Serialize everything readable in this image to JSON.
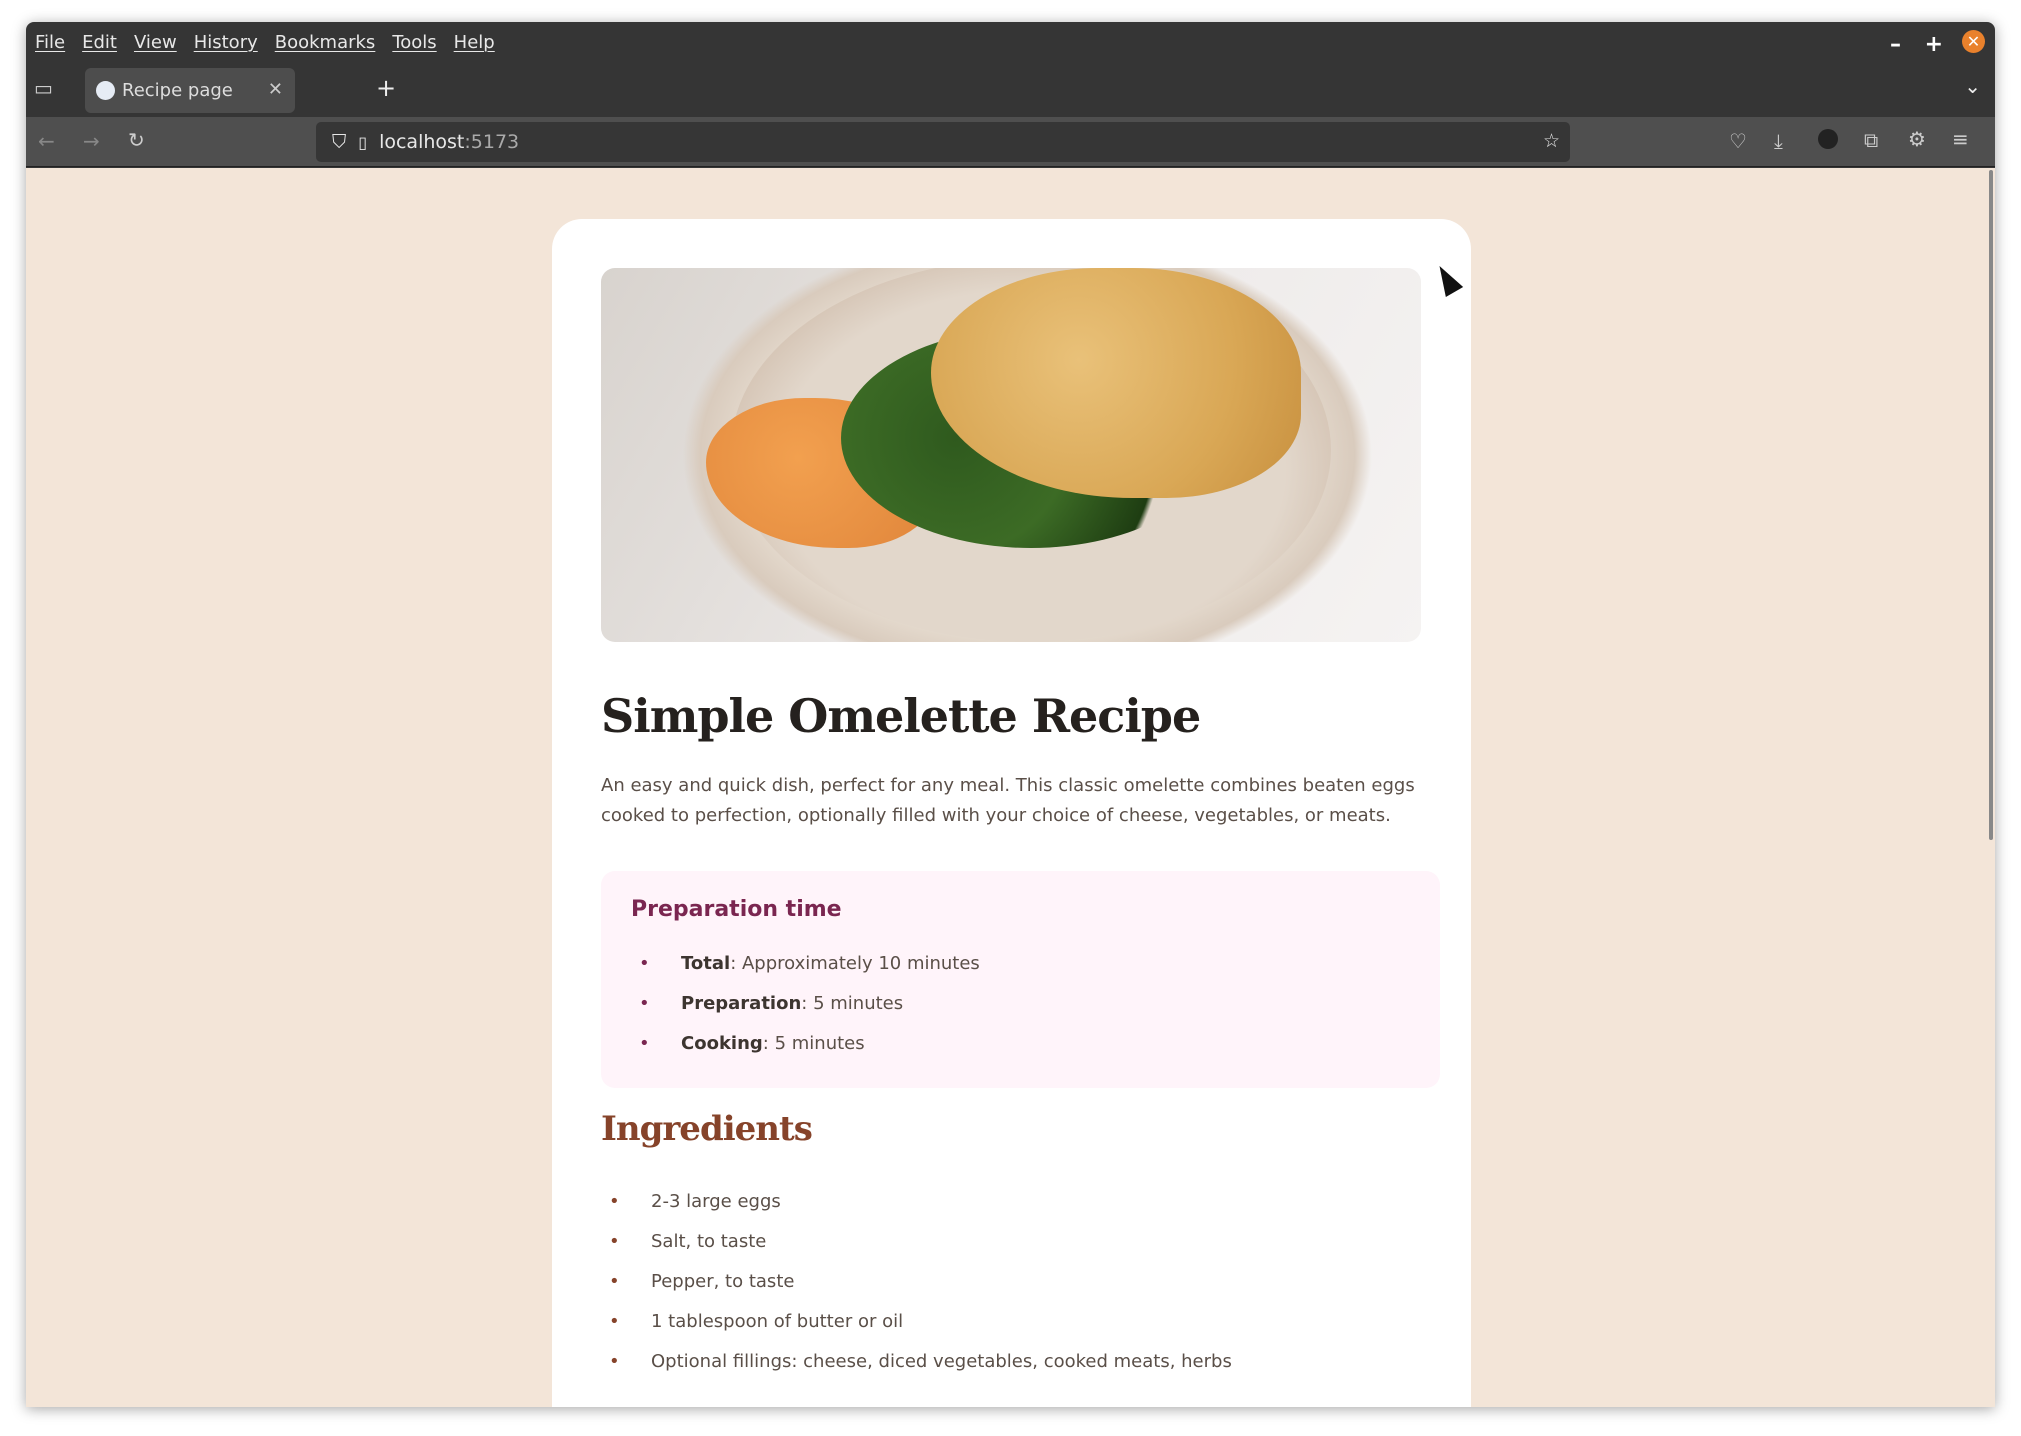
{
  "browser": {
    "menu": [
      "File",
      "Edit",
      "View",
      "History",
      "Bookmarks",
      "Tools",
      "Help"
    ],
    "tab_title": "Recipe page",
    "url_host": "localhost",
    "url_port": ":5173",
    "accent_close": "#e9812c"
  },
  "recipe": {
    "title": "Simple Omelette Recipe",
    "intro": "An easy and quick dish, perfect for any meal. This classic omelette combines beaten eggs cooked to perfection, optionally filled with your choice of cheese, vegetables, or meats.",
    "prep": {
      "heading": "Preparation time",
      "items": [
        {
          "label": "Total",
          "value": ": Approximately 10 minutes"
        },
        {
          "label": "Preparation",
          "value": ": 5 minutes"
        },
        {
          "label": "Cooking",
          "value": ": 5 minutes"
        }
      ]
    },
    "ingredients": {
      "heading": "Ingredients",
      "items": [
        "2-3 large eggs",
        "Salt, to taste",
        "Pepper, to taste",
        "1 tablespoon of butter or oil",
        "Optional fillings: cheese, diced vegetables, cooked meats, herbs"
      ]
    },
    "colors": {
      "background": "#f3e5d8",
      "prep_heading": "#7a2650",
      "ingredients_heading": "#86432a"
    }
  }
}
